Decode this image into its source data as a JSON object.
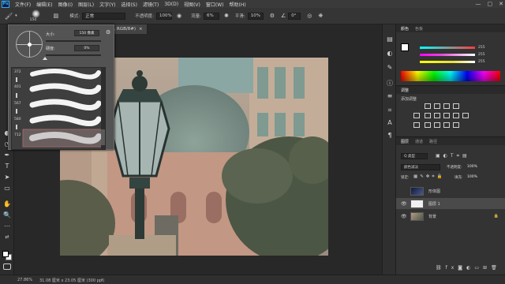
{
  "app": {
    "logo": "Ps"
  },
  "menubar": {
    "items": [
      "文件(F)",
      "编辑(E)",
      "图像(I)",
      "图层(L)",
      "文字(Y)",
      "选择(S)",
      "滤镜(T)",
      "3D(D)",
      "视图(V)",
      "窗口(W)",
      "帮助(H)"
    ],
    "win_min": "—",
    "win_max": "▢",
    "win_close": "✕"
  },
  "options": {
    "brush_size": "150",
    "mode_label": "模式:",
    "mode_value": "正常",
    "opacity_label": "不透明度:",
    "opacity_value": "100%",
    "flow_label": "流量:",
    "flow_value": "6%",
    "smooth_label": "平滑:",
    "smooth_value": "10%",
    "angle_value": "0°"
  },
  "brush_popup": {
    "size_label": "大小:",
    "size_value": "150 像素",
    "hardness_label": "硬度:",
    "hardness_value": "0%",
    "brush_numbers": [
      "372",
      "401",
      "567",
      "580",
      "712"
    ]
  },
  "document": {
    "tab_title": "1, RGB/8#)",
    "tab_close": "×"
  },
  "status": {
    "zoom": "27.86%",
    "info": "31.08 厘米 x 23.05 厘米 (300 ppi)"
  },
  "panels": {
    "color_tabs": [
      "颜色",
      "色板"
    ],
    "rgb_values": [
      "255",
      "255",
      "255"
    ],
    "adjust_tabs": [
      "调整"
    ],
    "adjust_add_label": "添加调整",
    "layers_tabs": [
      "图层",
      "通道",
      "路径"
    ],
    "kind_filter": "Q 类型",
    "blend_mode": "颜色减淡",
    "opacity_label": "不透明度:",
    "opacity_value": "100%",
    "lock_label": "锁定:",
    "fill_label": "填充:",
    "fill_value": "100%",
    "layers": [
      {
        "name": "形体图",
        "visible": false
      },
      {
        "name": "图层 1",
        "visible": true
      },
      {
        "name": "背景",
        "visible": true
      }
    ],
    "colors": {
      "rgb_r": "#ff3b3b",
      "rgb_g": "#e24bd6",
      "rgb_b": "#e6e03a",
      "accent": "#31a8ff"
    }
  }
}
